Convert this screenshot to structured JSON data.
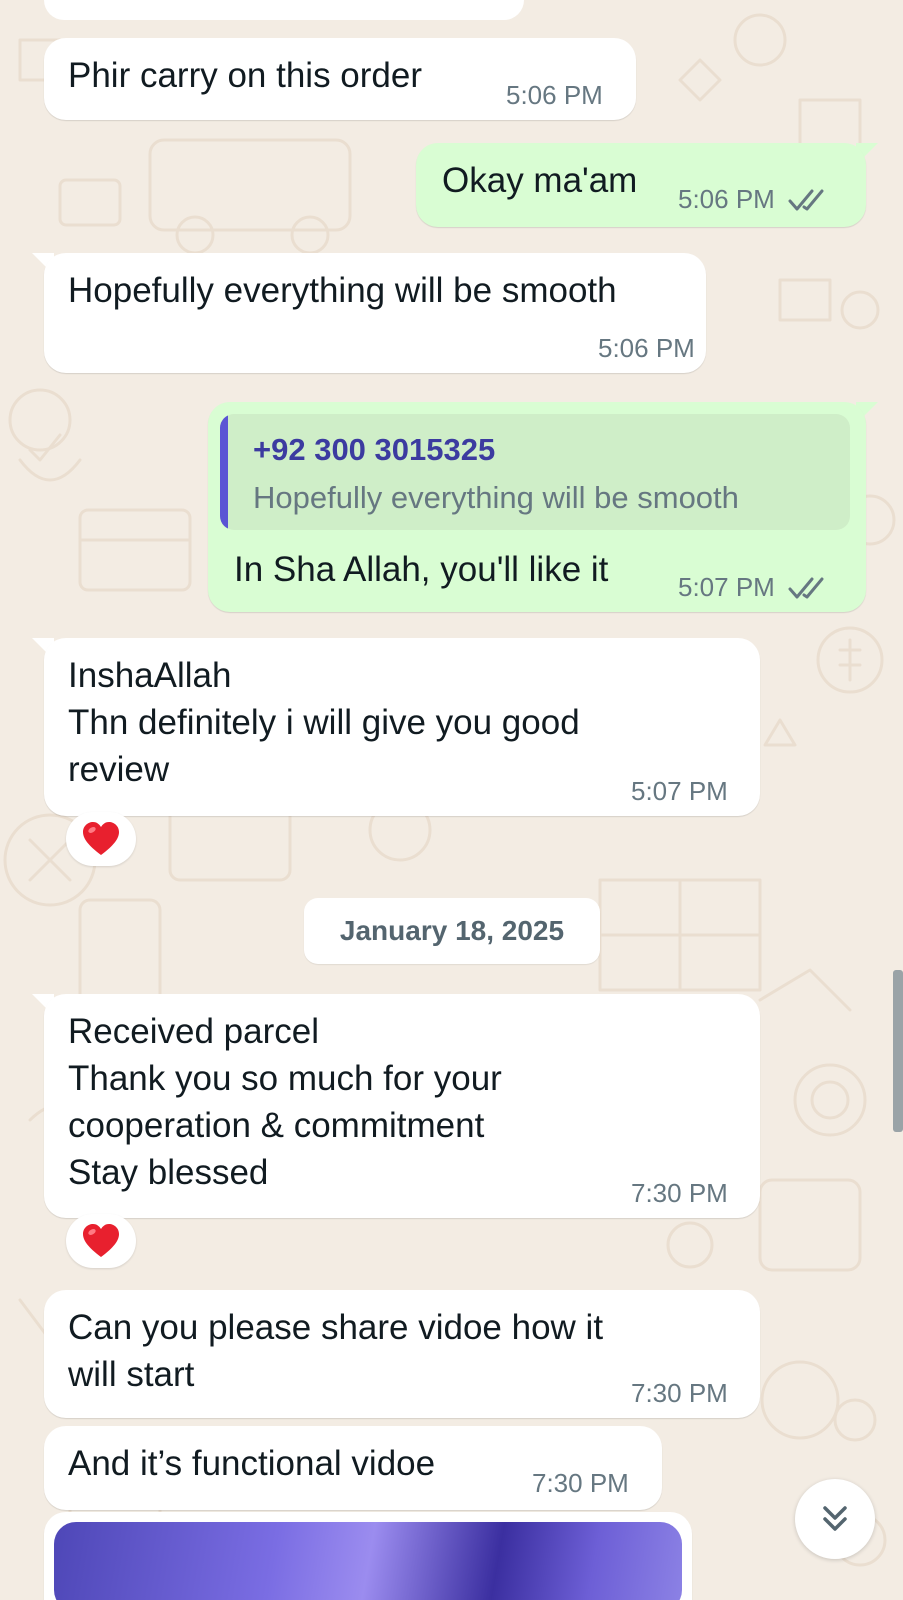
{
  "chat": {
    "messages": [
      {
        "id": "m1",
        "direction": "incoming",
        "text": "Phir carry on this order",
        "time": "5:06 PM"
      },
      {
        "id": "m2",
        "direction": "outgoing",
        "text": "Okay ma'am",
        "time": "5:06 PM",
        "status": "read"
      },
      {
        "id": "m3",
        "direction": "incoming",
        "text": "Hopefully everything will be smooth",
        "time": "5:06 PM"
      },
      {
        "id": "m4",
        "direction": "outgoing",
        "quoted_sender": "+92 300 3015325",
        "quoted_text": "Hopefully everything will be smooth",
        "text": "In Sha Allah, you'll like it",
        "time": "5:07 PM",
        "status": "read"
      },
      {
        "id": "m5",
        "direction": "incoming",
        "text": "InshaAllah\nThn definitely i will give you good\nreview",
        "time": "5:07 PM",
        "reaction": "❤️"
      },
      {
        "id": "m6",
        "direction": "incoming",
        "text": "Received parcel\nThank you so much for your\ncooperation & commitment\nStay blessed",
        "time": "7:30 PM",
        "reaction": "❤️"
      },
      {
        "id": "m7",
        "direction": "incoming",
        "text": "Can you please share vidoe how it\nwill start",
        "time": "7:30 PM"
      },
      {
        "id": "m8",
        "direction": "incoming",
        "text": "And it’s functional vidoe",
        "time": "7:30 PM"
      }
    ],
    "date_separator": "January 18, 2025"
  },
  "icons": {
    "read_receipt": "double-check-icon",
    "reaction_heart": "red-heart-icon",
    "scroll_down": "double-chevron-down-icon"
  },
  "colors": {
    "incoming_bubble": "#ffffff",
    "outgoing_bubble": "#d9fdd3",
    "read_tick": "#667781",
    "quote_accent": "#5b54d4",
    "wallpaper": "#f3ece3"
  }
}
